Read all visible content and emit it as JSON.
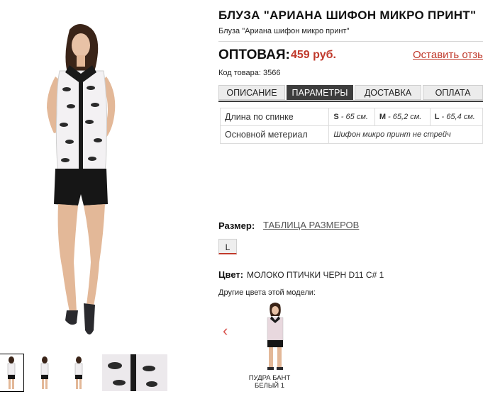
{
  "product": {
    "title": "БЛУЗА \"АРИАНА ШИФОН МИКРО ПРИНТ\"",
    "subtitle": "Блуза \"Ариана шифон микро принт\"",
    "price_label": "ОПТОВАЯ:",
    "price_value": "459 руб.",
    "review_link": "Оставить отзыв",
    "sku": "Код товара: 3566"
  },
  "tabs": [
    {
      "label": "ОПИСАНИЕ",
      "active": false
    },
    {
      "label": "ПАРАМЕТРЫ",
      "active": true
    },
    {
      "label": "ДОСТАВКА",
      "active": false
    },
    {
      "label": "ОПЛАТА",
      "active": false
    }
  ],
  "params": {
    "rows": [
      {
        "name": "Длина по спинке",
        "values": [
          {
            "size": "S",
            "value": " - 65 см."
          },
          {
            "size": "M",
            "value": " - 65,2 см."
          },
          {
            "size": "L",
            "value": " - 65,4 см."
          }
        ]
      },
      {
        "name": "Основной метериал",
        "value": "Шифон микро принт не стрейч"
      }
    ]
  },
  "size": {
    "label": "Размер:",
    "table_link": "ТАБЛИЦА РАЗМЕРОВ",
    "options": [
      "L"
    ]
  },
  "color": {
    "label": "Цвет:",
    "value": "МОЛОКО ПТИЧКИ ЧЕРН D11 С# 1",
    "other_label": "Другие цвета этой модели:",
    "prev_arrow": "‹",
    "variant_name": "ПУДРА БАНТ БЕЛЫЙ 1"
  },
  "colors": {
    "accent": "#c0392b",
    "tab_active": "#3d3d3d"
  }
}
